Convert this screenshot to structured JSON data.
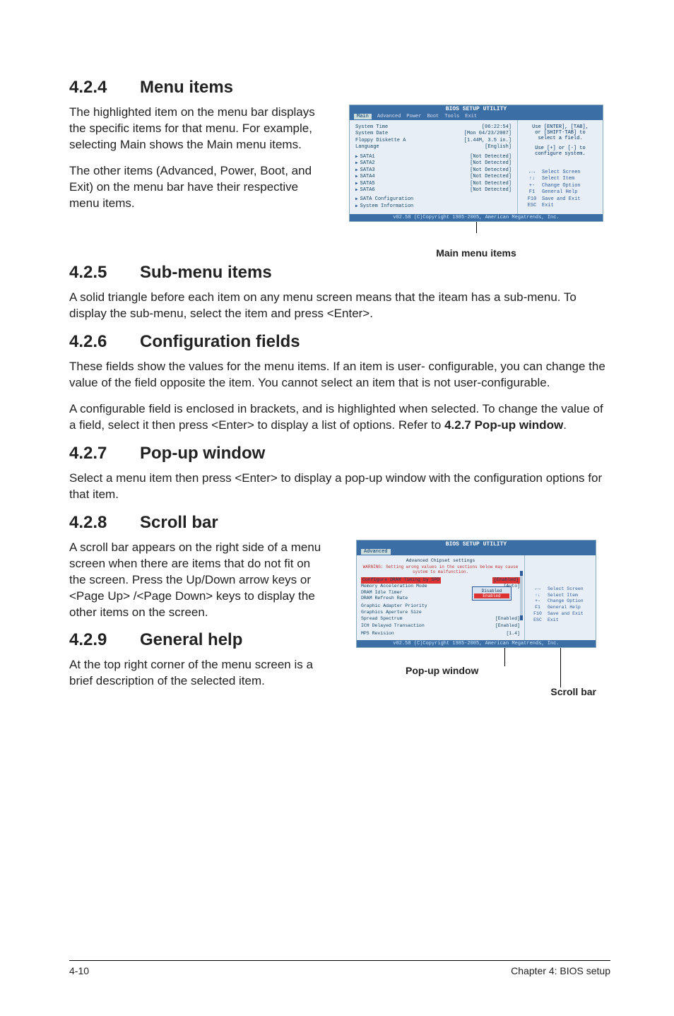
{
  "sections": {
    "s424": {
      "num": "4.2.4",
      "title": "Menu items",
      "p1": "The highlighted item on the menu bar displays the specific items for that menu. For example, selecting Main shows the Main menu items.",
      "p2": "The other items (Advanced, Power, Boot, and Exit) on the menu bar have their respective menu items."
    },
    "s425": {
      "num": "4.2.5",
      "title": "Sub-menu items",
      "p1": "A solid triangle before each item on any menu screen means that the iteam has a sub-menu. To display the sub-menu, select the item and press <Enter>."
    },
    "s426": {
      "num": "4.2.6",
      "title": "Configuration fields",
      "p1": "These fields show the values for the menu items. If an item is user- configurable, you can change the value of the field opposite the item. You cannot select an item that is not user-configurable.",
      "p2a": "A configurable field is enclosed in brackets, and is highlighted when selected. To change the value of a field, select it then press <Enter> to display a list of options. Refer to ",
      "p2bold": "4.2.7 Pop-up window",
      "p2b": "."
    },
    "s427": {
      "num": "4.2.7",
      "title": "Pop-up window",
      "p1": "Select a menu item then press <Enter> to display a pop-up window with the configuration options for that item."
    },
    "s428": {
      "num": "4.2.8",
      "title": "Scroll bar",
      "p1": "A scroll bar appears on the right side of a menu screen when there are items that do not fit on the screen. Press the Up/Down arrow keys or <Page Up> /<Page Down> keys to display the other items on the screen."
    },
    "s429": {
      "num": "4.2.9",
      "title": "General help",
      "p1": "At the top right corner of the menu screen is a brief description of the selected item."
    }
  },
  "fig1": {
    "title": "BIOS SETUP UTILITY",
    "tabs": [
      "Main",
      "Advanced",
      "Power",
      "Boot",
      "Tools",
      "Exit"
    ],
    "rows": [
      {
        "k": "System Time",
        "v": "[06:22:54]"
      },
      {
        "k": "System Date",
        "v": "[Mon 04/23/2007]"
      },
      {
        "k": "Floppy Diskette A",
        "v": "[1.44M, 3.5 in.]"
      },
      {
        "k": "Language",
        "v": "[English]"
      }
    ],
    "sata": [
      {
        "k": "SATA1",
        "v": "[Not Detected]"
      },
      {
        "k": "SATA2",
        "v": "[Not Detected]"
      },
      {
        "k": "SATA3",
        "v": "[Not Detected]"
      },
      {
        "k": "SATA4",
        "v": "[Not Detected]"
      },
      {
        "k": "SATA5",
        "v": "[Not Detected]"
      },
      {
        "k": "SATA6",
        "v": "[Not Detected]"
      }
    ],
    "subs": [
      "SATA Configuration",
      "System Information"
    ],
    "helpTop": [
      "Use [ENTER], [TAB],",
      "or [SHIFT-TAB] to",
      "select a field.",
      "",
      "Use [+] or [-] to",
      "configure system."
    ],
    "navKeys": [
      {
        "k": "←→",
        "v": "Select Screen"
      },
      {
        "k": "↑↓",
        "v": "Select Item"
      },
      {
        "k": "+-",
        "v": "Change Option"
      },
      {
        "k": "F1",
        "v": "General Help"
      },
      {
        "k": "F10",
        "v": "Save and Exit"
      },
      {
        "k": "ESC",
        "v": "Exit"
      }
    ],
    "foot": "v02.58 (C)Copyright 1985-2005, American Megatrends, Inc.",
    "caption": "Main menu items"
  },
  "fig2": {
    "title": "BIOS SETUP UTILITY",
    "tab": "Advanced",
    "heading": "Advanced Chipset settings",
    "warning": "WARNING: Setting wrong values in the sections below may cause system to malfunction.",
    "rows": [
      {
        "k": "Configure DRAM Timing by SPD",
        "v": "[Enabled]"
      },
      {
        "k": "Memory Acceleration Mode",
        "v": "[Auto]"
      },
      {
        "k": "DRAM Idle Timer",
        "v": ""
      },
      {
        "k": "DRAM Refresh Rate",
        "v": ""
      },
      {
        "k": "Graphic Adapter Priority",
        "v": ""
      },
      {
        "k": "Graphics Aperture Size",
        "v": ""
      },
      {
        "k": "Spread Spectrum",
        "v": "[Enabled]"
      },
      {
        "k": "ICH Delayed Transaction",
        "v": "[Enabled]"
      },
      {
        "k": "MPS Revision",
        "v": "[1.4]"
      }
    ],
    "popup": [
      "Disabled",
      "Enabled"
    ],
    "navKeys": [
      {
        "k": "←→",
        "v": "Select Screen"
      },
      {
        "k": "↑↓",
        "v": "Select Item"
      },
      {
        "k": "+-",
        "v": "Change Option"
      },
      {
        "k": "F1",
        "v": "General Help"
      },
      {
        "k": "F10",
        "v": "Save and Exit"
      },
      {
        "k": "ESC",
        "v": "Exit"
      }
    ],
    "foot": "v02.58 (C)Copyright 1985-2005, American Megatrends, Inc.",
    "captionPopup": "Pop-up window",
    "captionScroll": "Scroll bar"
  },
  "footer": {
    "left": "4-10",
    "right": "Chapter 4: BIOS setup"
  }
}
